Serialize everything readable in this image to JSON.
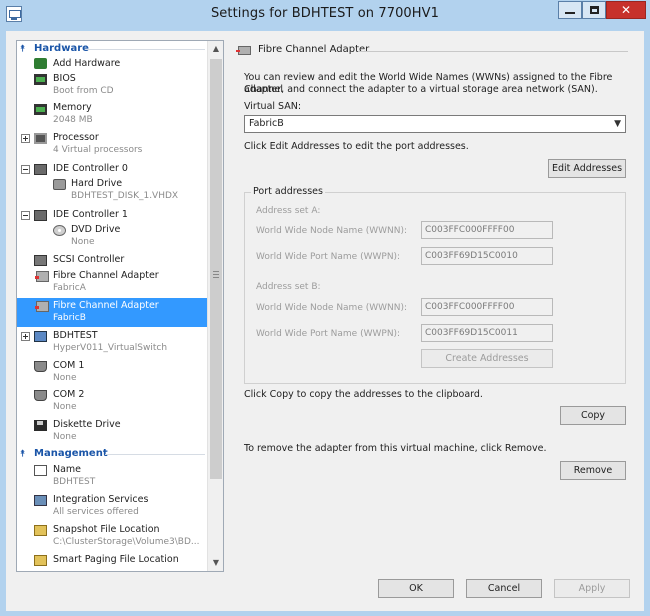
{
  "window": {
    "title": "Settings for BDHTEST on 7700HV1",
    "minimize": "–",
    "maximize": "□",
    "close": "✕"
  },
  "tree": {
    "hardware_header": "Hardware",
    "management_header": "Management",
    "items": [
      {
        "label": "Add Hardware",
        "sub": ""
      },
      {
        "label": "BIOS",
        "sub": "Boot from CD"
      },
      {
        "label": "Memory",
        "sub": "2048 MB"
      },
      {
        "label": "Processor",
        "sub": "4 Virtual processors"
      },
      {
        "label": "IDE Controller 0",
        "sub": ""
      },
      {
        "label": "Hard Drive",
        "sub": "BDHTEST_DISK_1.VHDX"
      },
      {
        "label": "IDE Controller 1",
        "sub": ""
      },
      {
        "label": "DVD Drive",
        "sub": "None"
      },
      {
        "label": "SCSI Controller",
        "sub": ""
      },
      {
        "label": "Fibre Channel Adapter",
        "sub": "FabricA"
      },
      {
        "label": "Fibre Channel Adapter",
        "sub": "FabricB"
      },
      {
        "label": "BDHTEST",
        "sub": "HyperV011_VirtualSwitch"
      },
      {
        "label": "COM 1",
        "sub": "None"
      },
      {
        "label": "COM 2",
        "sub": "None"
      },
      {
        "label": "Diskette Drive",
        "sub": "None"
      }
    ],
    "mgmt_items": [
      {
        "label": "Name",
        "sub": "BDHTEST"
      },
      {
        "label": "Integration Services",
        "sub": "All services offered"
      },
      {
        "label": "Snapshot File Location",
        "sub": "C:\\ClusterStorage\\Volume3\\BD..."
      },
      {
        "label": "Smart Paging File Location",
        "sub": ""
      }
    ]
  },
  "panel": {
    "title": "Fibre Channel Adapter",
    "intro_line1": "You can review and edit the World Wide Names (WWNs) assigned to the Fibre Channel",
    "intro_line2": "adapter, and connect the adapter to a virtual storage area network (SAN).",
    "vsan_label": "Virtual SAN:",
    "vsan_value": "FabricB",
    "edit_hint": "Click Edit Addresses to edit the port addresses.",
    "edit_button": "Edit Addresses",
    "port_addresses_title": "Port addresses",
    "set_a_label": "Address set A:",
    "set_b_label": "Address set B:",
    "wwnn_label": "World Wide Node Name (WWNN):",
    "wwpn_label": "World Wide Port Name (WWPN):",
    "set_a_wwnn": "C003FFC000FFFF00",
    "set_a_wwpn": "C003FF69D15C0010",
    "set_b_wwnn": "C003FFC000FFFF00",
    "set_b_wwpn": "C003FF69D15C0011",
    "create_button": "Create Addresses",
    "copy_hint": "Click Copy to copy the addresses to the clipboard.",
    "copy_button": "Copy",
    "remove_hint": "To remove the adapter from this virtual machine, click Remove.",
    "remove_button": "Remove"
  },
  "footer": {
    "ok": "OK",
    "cancel": "Cancel",
    "apply": "Apply"
  },
  "colors": {
    "selection": "#3399ff",
    "section_header": "#1a55a8",
    "close_button": "#c7312b"
  }
}
